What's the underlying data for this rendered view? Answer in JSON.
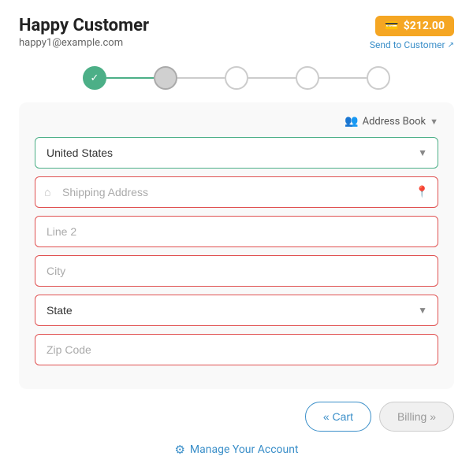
{
  "customer": {
    "name": "Happy Customer",
    "email": "happy1@example.com"
  },
  "price": {
    "amount": "$212.00",
    "send_label": "Send to Customer"
  },
  "stepper": {
    "steps": [
      {
        "id": 1,
        "state": "completed"
      },
      {
        "id": 2,
        "state": "active"
      },
      {
        "id": 3,
        "state": "default"
      },
      {
        "id": 4,
        "state": "default"
      },
      {
        "id": 5,
        "state": "default"
      }
    ]
  },
  "form": {
    "address_book_label": "Address Book",
    "country": {
      "value": "United States",
      "placeholder": "United States"
    },
    "shipping_address": {
      "placeholder": "Shipping Address"
    },
    "line2": {
      "placeholder": "Line 2"
    },
    "city": {
      "placeholder": "City"
    },
    "state": {
      "placeholder": "State"
    },
    "zip": {
      "placeholder": "Zip Code"
    }
  },
  "buttons": {
    "cart": "« Cart",
    "billing": "Billing »"
  },
  "manage_account": "Manage Your Account"
}
